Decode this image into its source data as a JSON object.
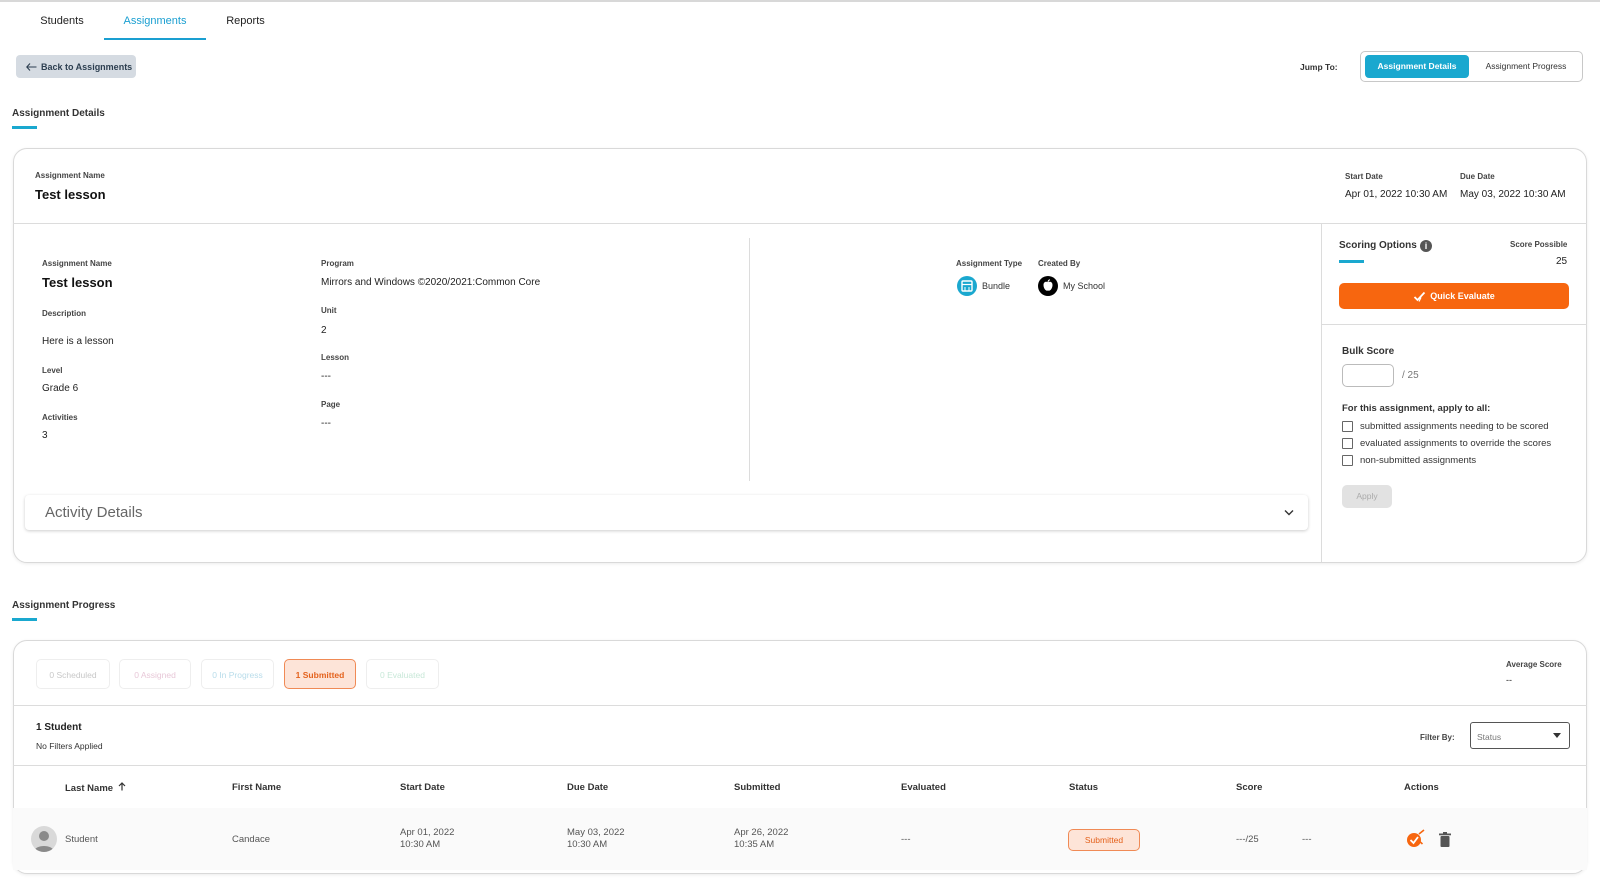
{
  "tabs": [
    {
      "label": "Students"
    },
    {
      "label": "Assignments"
    },
    {
      "label": "Reports"
    }
  ],
  "back_label": "Back to Assignments",
  "jump": {
    "label": "Jump To:",
    "options": [
      "Assignment Details",
      "Assignment Progress"
    ],
    "active": "Assignment Details"
  },
  "details_section_title": "Assignment Details",
  "header": {
    "name_label": "Assignment Name",
    "name": "Test lesson",
    "start_label": "Start Date",
    "start": "Apr 01, 2022 10:30 AM",
    "due_label": "Due Date",
    "due": "May 03, 2022 10:30 AM"
  },
  "info": {
    "name_label": "Assignment Name",
    "name": "Test lesson",
    "description_label": "Description",
    "description": "Here is a lesson",
    "level_label": "Level",
    "level": "Grade 6",
    "activities_label": "Activities",
    "activities": "3",
    "program_label": "Program",
    "program": "Mirrors and Windows ©2020/2021:Common Core",
    "unit_label": "Unit",
    "unit": "2",
    "lesson_label": "Lesson",
    "lesson": "---",
    "page_label": "Page",
    "page": "---",
    "type_label": "Assignment Type",
    "type": "Bundle",
    "created_label": "Created By",
    "created": "My School"
  },
  "activity_details_label": "Activity Details",
  "scoring": {
    "title": "Scoring Options",
    "score_possible_label": "Score Possible",
    "score_possible": "25",
    "quick_evaluate": "Quick Evaluate",
    "bulk_score_label": "Bulk Score",
    "bulk_score_value": "",
    "bulk_total": "/ 25",
    "apply_all_label": "For this assignment, apply to all:",
    "options": [
      "submitted assignments needing to be scored",
      "evaluated assignments to override the scores",
      "non-submitted assignments"
    ],
    "apply": "Apply"
  },
  "progress_section_title": "Assignment Progress",
  "status_pills": [
    {
      "label": "0 Scheduled",
      "color": "#c8c8c8"
    },
    {
      "label": "0 Assigned",
      "color": "#e8c8d8"
    },
    {
      "label": "0 In Progress",
      "color": "#b8dcea"
    },
    {
      "label": "1 Submitted",
      "color": "#e4621d"
    },
    {
      "label": "0 Evaluated",
      "color": "#c8e8d8"
    }
  ],
  "average_score_label": "Average Score",
  "average_score": "--",
  "student_count": "1 Student",
  "filters_text": "No Filters Applied",
  "filter_by_label": "Filter By:",
  "filter_placeholder": "Status",
  "table": {
    "headers": [
      "Last Name",
      "First Name",
      "Start Date",
      "Due Date",
      "Submitted",
      "Evaluated",
      "Status",
      "Score",
      "Actions"
    ],
    "rows": [
      {
        "last": "Student",
        "first": "Candace",
        "start_date": "Apr 01, 2022",
        "start_time": "10:30 AM",
        "due_date": "May 03, 2022",
        "due_time": "10:30 AM",
        "submitted_date": "Apr 26, 2022",
        "submitted_time": "10:35 AM",
        "evaluated": "---",
        "status": "Submitted",
        "score": "---/25",
        "score_extra": "---"
      }
    ]
  },
  "colors": {
    "accent": "#1aa8cf",
    "orange": "#f7660f"
  }
}
